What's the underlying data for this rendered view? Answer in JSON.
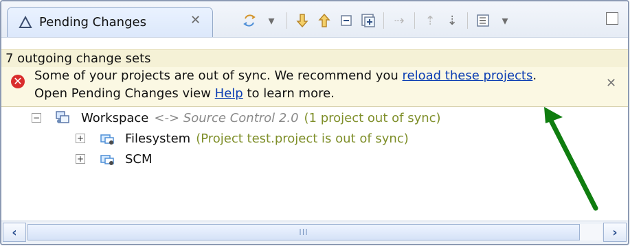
{
  "tab": {
    "title": "Pending Changes",
    "icon": "triangle-icon",
    "close_icon": "close-icon"
  },
  "toolbar": {
    "buttons": [
      {
        "icon": "sync-icon"
      },
      {
        "icon": "dropdown-icon"
      },
      {
        "icon": "arrow-down-icon"
      },
      {
        "icon": "arrow-up-icon"
      },
      {
        "icon": "collapse-all-icon"
      },
      {
        "icon": "expand-all-icon"
      },
      {
        "icon": "disabled-action-icon"
      },
      {
        "icon": "disabled-action-2-icon"
      },
      {
        "icon": "disabled-action-3-icon"
      },
      {
        "icon": "view-menu-icon"
      },
      {
        "icon": "dropdown-icon"
      }
    ]
  },
  "status": {
    "text": "7 outgoing change sets"
  },
  "banner": {
    "line1_prefix": "Some of your projects are out of sync. We recommend you ",
    "line1_link": "reload these projects",
    "line1_suffix": ".",
    "line2_prefix": "Open Pending Changes view ",
    "line2_link": "Help",
    "line2_suffix": " to learn more."
  },
  "tree": {
    "workspace": {
      "label": "Workspace",
      "mapping": "<-> Source Control 2.0",
      "status": "(1 project out of sync)"
    },
    "children": [
      {
        "label": "Filesystem",
        "status": "(Project test.project is out of sync)"
      },
      {
        "label": "SCM",
        "status": ""
      }
    ]
  },
  "scrollbar": {
    "thumb_text": "III"
  },
  "colors": {
    "error": "#d92d2d",
    "link": "#0b3db3",
    "arrow": "#0f7d0f",
    "banner": "#fbf8e3"
  }
}
